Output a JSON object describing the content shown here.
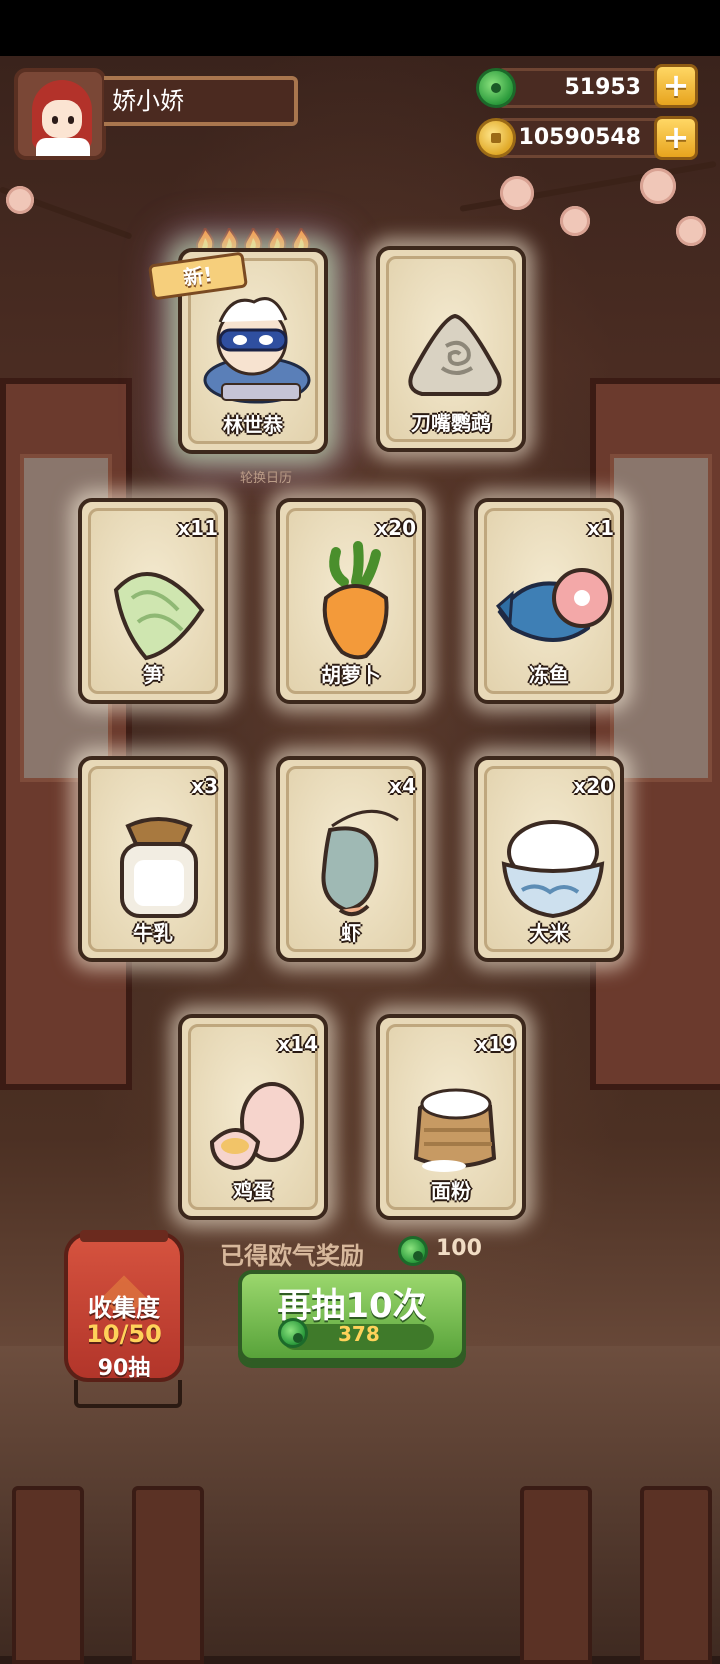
{
  "player": {
    "name": "娇小娇"
  },
  "currency": {
    "jade": "51953",
    "coins": "10590548"
  },
  "hero_card": {
    "tag": "新!",
    "name": "林世恭",
    "stars": 5
  },
  "card_row1": [
    {
      "name": "刀嘴鹦鹉",
      "count": ""
    }
  ],
  "hint": "轮换日历",
  "cards": [
    {
      "name": "笋",
      "count": "x11",
      "art": "bamboo-shoot"
    },
    {
      "name": "胡萝卜",
      "count": "x20",
      "art": "carrot"
    },
    {
      "name": "冻鱼",
      "count": "x1",
      "art": "frozen-fish"
    },
    {
      "name": "牛乳",
      "count": "x3",
      "art": "milk-jar"
    },
    {
      "name": "虾",
      "count": "x4",
      "art": "shrimp"
    },
    {
      "name": "大米",
      "count": "x20",
      "art": "rice-bowl"
    },
    {
      "name": "鸡蛋",
      "count": "x14",
      "art": "eggs"
    },
    {
      "name": "面粉",
      "count": "x19",
      "art": "flour-sack"
    }
  ],
  "reward": {
    "label": "已得欧气奖励",
    "value": "100"
  },
  "draw_button": {
    "label": "再抽10次",
    "cost": "378"
  },
  "collection": {
    "title": "收集度",
    "progress": "10/50",
    "draws": "90抽"
  },
  "colors": {
    "jade": "#2a9a3b",
    "gold": "#e0a928",
    "button_green": "#58a33a",
    "lantern_red": "#b2352a"
  }
}
